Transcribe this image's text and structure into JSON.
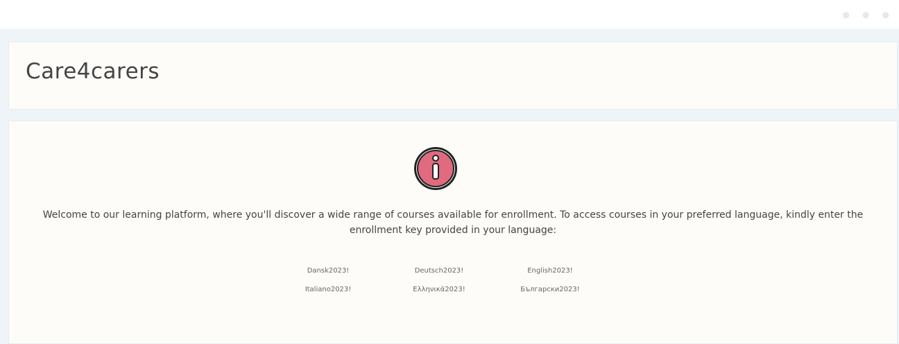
{
  "header": {
    "title": "Care4carers"
  },
  "main": {
    "welcome_text": "Welcome to our learning platform, where you'll discover a wide range of courses available for enrollment. To access courses in your preferred language, kindly enter the enrollment key provided in your language:",
    "enrollment_keys": [
      "Dansk2023!",
      "Deutsch2023!",
      "English2023!",
      "Italiano2023!",
      "Ελληνικά2023!",
      "Български2023!"
    ],
    "icon": "info-icon",
    "accent_color": "#e06a7e"
  }
}
